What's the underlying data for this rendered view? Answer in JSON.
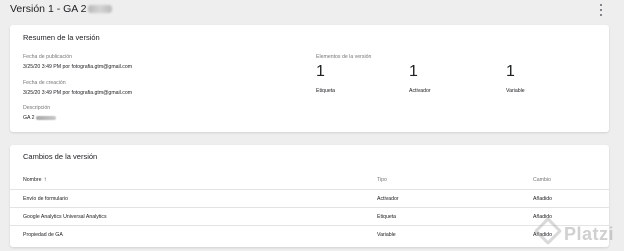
{
  "header": {
    "title": "Versión 1 - GA 2"
  },
  "summary": {
    "title": "Resumen de la versión",
    "publication": {
      "label": "Fecha de publicación",
      "value": "3/25/20 3:49 PM por fotografia.gtm@gmail.com"
    },
    "creation": {
      "label": "Fecha de creación",
      "value": "3/25/20 3:49 PM por fotografia.gtm@gmail.com"
    },
    "description": {
      "label": "Descripción",
      "value": "GA 2"
    },
    "elements": {
      "label": "Elementos de la versión",
      "items": [
        {
          "count": "1",
          "label": "Etiqueta"
        },
        {
          "count": "1",
          "label": "Activador"
        },
        {
          "count": "1",
          "label": "Variable"
        }
      ]
    }
  },
  "changes": {
    "title": "Cambios de la versión",
    "columns": {
      "name": "Nombre",
      "sort_icon": "arrow-up-icon",
      "type": "Tipo",
      "change": "Cambio"
    },
    "rows": [
      {
        "name": "Envío de formulario",
        "type": "Activador",
        "change": "Añadido"
      },
      {
        "name": "Google Analytics Universal Analytics",
        "type": "Etiqueta",
        "change": "Añadido"
      },
      {
        "name": "Propiedad de GA",
        "type": "Variable",
        "change": "Añadido"
      }
    ]
  },
  "watermark": {
    "text": "Platzi"
  }
}
